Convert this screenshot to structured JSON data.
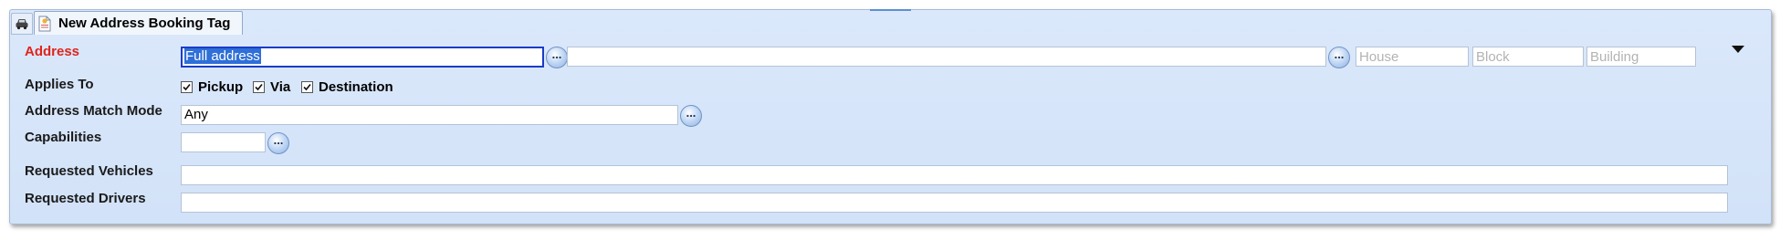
{
  "tab": {
    "title": "New Address Booking Tag"
  },
  "fields": {
    "address": {
      "label": "Address",
      "value": "Full address",
      "second_value": "",
      "house_placeholder": "House",
      "block_placeholder": "Block",
      "building_placeholder": "Building"
    },
    "applies_to": {
      "label": "Applies To",
      "options": [
        {
          "label": "Pickup",
          "checked": true
        },
        {
          "label": "Via",
          "checked": true
        },
        {
          "label": "Destination",
          "checked": true
        }
      ]
    },
    "match_mode": {
      "label": "Address Match Mode",
      "value": "Any"
    },
    "capabilities": {
      "label": "Capabilities",
      "value": ""
    },
    "requested_vehicles": {
      "label": "Requested Vehicles",
      "value": ""
    },
    "requested_drivers": {
      "label": "Requested Drivers",
      "value": ""
    }
  },
  "buttons": {
    "ellipsis": "..."
  },
  "colors": {
    "required_label": "#e0241b",
    "focus_border": "#1a3cc8",
    "panel_bg": "#d6e5f9"
  }
}
